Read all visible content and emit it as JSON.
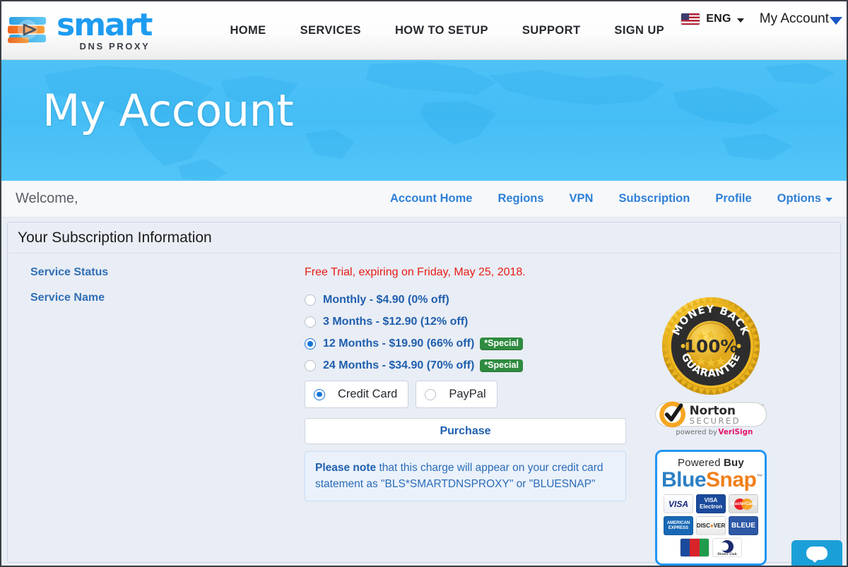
{
  "brand": {
    "name": "smart",
    "tagline": "DNS PROXY",
    "logo_icon": "play-button-logo-icon",
    "accent_blue": "#1e9bf0",
    "accent_orange": "#f47b20"
  },
  "topnav": {
    "items": [
      {
        "label": "HOME"
      },
      {
        "label": "SERVICES"
      },
      {
        "label": "HOW TO SETUP"
      },
      {
        "label": "SUPPORT"
      },
      {
        "label": "SIGN UP"
      }
    ],
    "language": {
      "label": "ENG",
      "flag_icon": "us-flag-icon",
      "caret_icon": "chevron-down-icon"
    },
    "account": {
      "label": "My Account",
      "caret_icon": "caret-down-icon"
    }
  },
  "hero": {
    "title": "My Account",
    "background_color": "#4fc2f7"
  },
  "welcome": {
    "text": "Welcome,",
    "nav": [
      {
        "label": "Account Home"
      },
      {
        "label": "Regions"
      },
      {
        "label": "VPN"
      },
      {
        "label": "Subscription"
      },
      {
        "label": "Profile"
      },
      {
        "label": "Options",
        "caret_icon": "caret-down-icon"
      }
    ]
  },
  "panel": {
    "title": "Your Subscription Information",
    "service_status": {
      "label": "Service Status",
      "value": "Free Trial, expiring on Friday, May 25, 2018.",
      "value_color": "#e81b14"
    },
    "service_name": {
      "label": "Service Name"
    },
    "plans": [
      {
        "label": "Monthly - $4.90 (0% off)",
        "selected": false,
        "badge": ""
      },
      {
        "label": "3 Months - $12.90 (12% off)",
        "selected": false,
        "badge": ""
      },
      {
        "label": "12 Months - $19.90 (66% off)",
        "selected": true,
        "badge": "*Special"
      },
      {
        "label": "24 Months - $34.90 (70% off)",
        "selected": false,
        "badge": "*Special"
      }
    ],
    "payment_methods": [
      {
        "label": "Credit Card",
        "selected": true
      },
      {
        "label": "PayPal",
        "selected": false
      }
    ],
    "purchase_button": "Purchase",
    "note_bold": "Please note",
    "note_rest": " that this charge will appear on your credit card statement as \"BLS*SMARTDNSPROXY\" or \"BLUESNAP\"",
    "badge_color": "#2e8b3f"
  },
  "trust": {
    "money_back": {
      "top_text": "MONEY BACK",
      "center_text": "100%",
      "bottom_text": "GUARANTEE"
    },
    "norton": {
      "name": "Norton",
      "sub": "SECURED",
      "powered": "powered by",
      "brand": "VeriSign"
    },
    "bluesnap": {
      "powered_prefix": "Powered ",
      "powered_bold": "Buy",
      "name_part1": "Blue",
      "name_part2": "Snap",
      "trademark": "™",
      "cards": [
        {
          "name": "VISA"
        },
        {
          "name": "VISA Electron"
        },
        {
          "name": "MasterCard"
        },
        {
          "name": "AMERICAN EXPRESS"
        },
        {
          "name": "DISCOVER"
        },
        {
          "name": "BLEUE"
        },
        {
          "name": "JCB"
        },
        {
          "name": "Diners Club International"
        }
      ]
    }
  },
  "chat_widget": {
    "icon": "chat-bubble-icon"
  }
}
